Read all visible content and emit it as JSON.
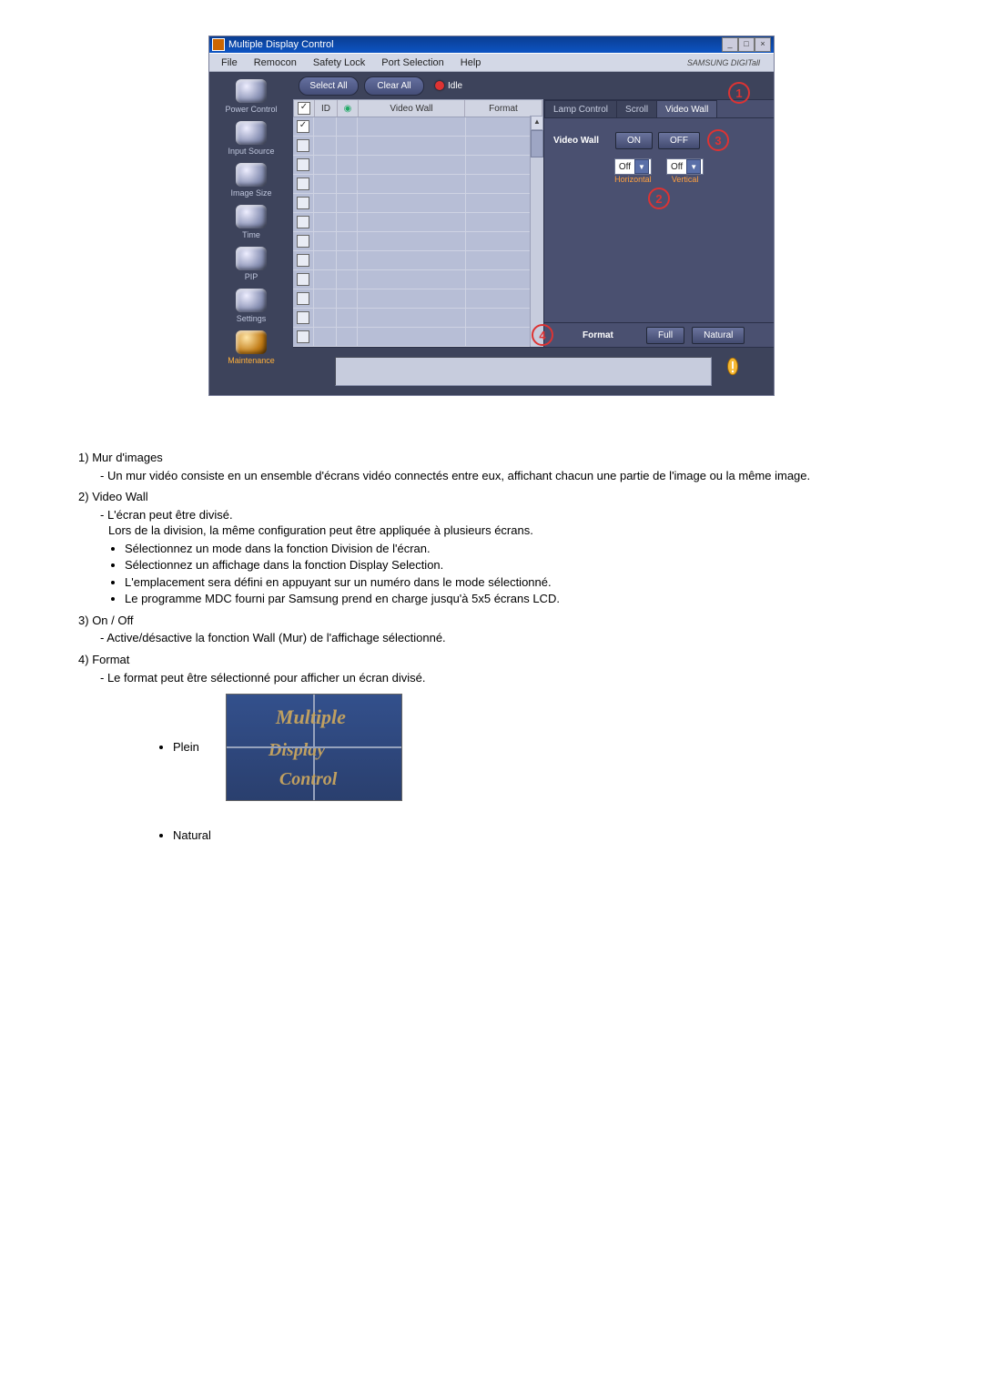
{
  "app": {
    "title": "Multiple Display Control",
    "menus": [
      "File",
      "Remocon",
      "Safety Lock",
      "Port Selection",
      "Help"
    ],
    "brand": "SAMSUNG DIGITall"
  },
  "sidebar": {
    "items": [
      {
        "label": "Power Control"
      },
      {
        "label": "Input Source"
      },
      {
        "label": "Image Size"
      },
      {
        "label": "Time"
      },
      {
        "label": "PIP"
      },
      {
        "label": "Settings"
      },
      {
        "label": "Maintenance",
        "active": true
      }
    ]
  },
  "toolbar": {
    "select_all": "Select All",
    "clear_all": "Clear All",
    "idle": "Idle"
  },
  "grid": {
    "headers": {
      "id": "ID",
      "videowall": "Video Wall",
      "format": "Format"
    },
    "rows": 12,
    "first_checked": true
  },
  "panel": {
    "tabs": [
      "Lamp Control",
      "Scroll",
      "Video Wall"
    ],
    "active_tab": 2,
    "videowall_label": "Video Wall",
    "on": "ON",
    "off": "OFF",
    "h_select": "Off",
    "v_select": "Off",
    "h_axis": "Horizontal",
    "v_axis": "Vertical",
    "format_label": "Format",
    "full": "Full",
    "natural": "Natural"
  },
  "markers": {
    "m1": "1",
    "m2": "2",
    "m3": "3",
    "m4": "4"
  },
  "doc": {
    "s1": {
      "n": "1)",
      "title": "Mur d'images",
      "p1": "- Un mur vidéo consiste en un ensemble d'écrans vidéo connectés entre eux, affichant chacun une partie de l'image ou la même image."
    },
    "s2": {
      "n": "2)",
      "title": "Video Wall",
      "p1": "- L'écran peut être divisé.",
      "p2": "Lors de la division, la même configuration peut être appliquée à plusieurs écrans.",
      "b1": "Sélectionnez un mode dans la fonction Division de l'écran.",
      "b2": "Sélectionnez un affichage dans la fonction Display Selection.",
      "b3": "L'emplacement sera défini en appuyant sur un numéro dans le mode sélectionné.",
      "b4": "Le programme MDC fourni par Samsung prend en charge jusqu'à 5x5 écrans LCD."
    },
    "s3": {
      "n": "3)",
      "title": "On / Off",
      "p1": "- Active/désactive la fonction Wall (Mur) de l'affichage sélectionné."
    },
    "s4": {
      "n": "4)",
      "title": "Format",
      "p1": "- Le format peut être sélectionné pour afficher un écran divisé.",
      "plein": "Plein",
      "natural": "Natural"
    },
    "mini": {
      "t1": "Multiple",
      "t2": "Display",
      "t3": "Control"
    }
  }
}
